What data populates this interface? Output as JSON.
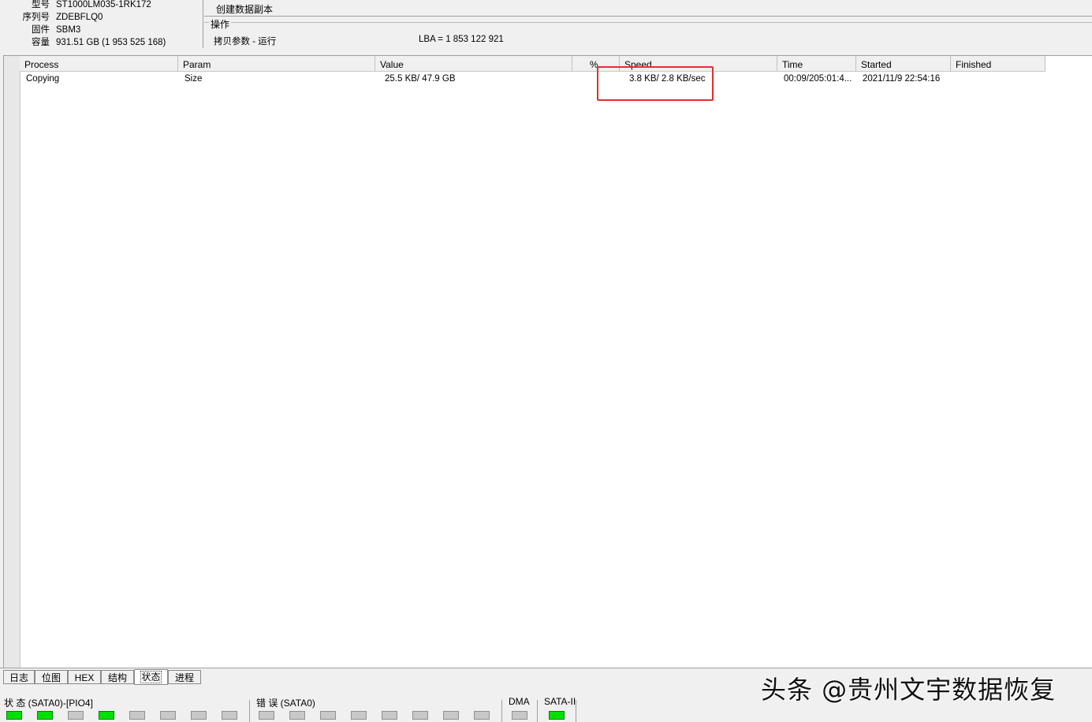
{
  "device_info": {
    "rows": [
      {
        "label": "型号",
        "value": "ST1000LM035-1RK172"
      },
      {
        "label": "序列号",
        "value": "ZDEBFLQ0"
      },
      {
        "label": "固件",
        "value": "SBM3"
      },
      {
        "label": "容量",
        "value": "931.51 GB (1 953 525 168)"
      }
    ]
  },
  "operation": {
    "title": "创建数据副本",
    "group_label": "操作",
    "status": "拷贝参数 - 运行",
    "lba": "LBA =   1 853 122 921"
  },
  "table": {
    "columns": [
      "Process",
      "Param",
      "Value",
      "%",
      "Speed",
      "Time",
      "Started",
      "Finished"
    ],
    "rows": [
      {
        "process": "Copying",
        "param": "Size",
        "value": "25.5 KB/ 47.9 GB",
        "percent": "",
        "speed": "3.8 KB/ 2.8 KB/sec",
        "time": "00:09/205:01:4...",
        "started": "2021/11/9 22:54:16",
        "finished": ""
      }
    ]
  },
  "tabs": [
    "日志",
    "位图",
    "HEX",
    "结构",
    "状态",
    "进程"
  ],
  "active_tab": "状态",
  "status_bar": {
    "state_label": "状 态 (SATA0)-[PIO4]",
    "state_leds": [
      true,
      true,
      false,
      true,
      false,
      false,
      false,
      false
    ],
    "error_label": "错 误 (SATA0)",
    "error_leds": [
      false,
      false,
      false,
      false,
      false,
      false,
      false,
      false
    ],
    "dma_label": "DMA",
    "dma_leds": [
      false
    ],
    "sata_label": "SATA-II",
    "sata_leds": [
      true
    ]
  },
  "watermark": "头条 @贵州文宇数据恢复",
  "colors": {
    "led_on": "#00e000",
    "led_off": "#c8c8c8",
    "highlight": "#e03030"
  }
}
